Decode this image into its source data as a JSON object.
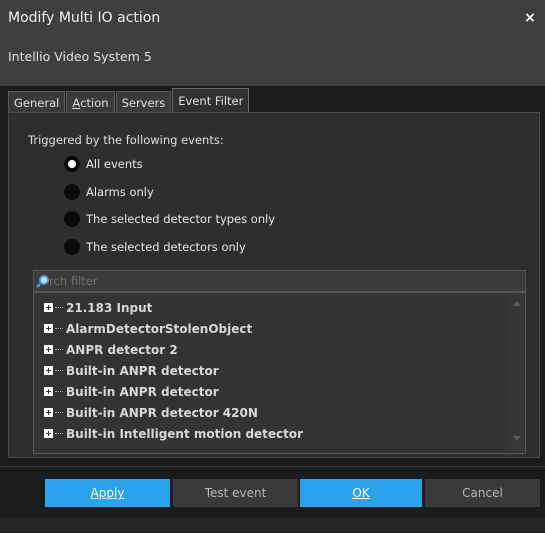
{
  "window": {
    "title": "Modify Multi IO action",
    "close_glyph": "×"
  },
  "subtitle": "Intellio Video System 5",
  "tabs": [
    {
      "label": "General",
      "active": false
    },
    {
      "label": "Action",
      "mnemonic": "A",
      "active": false
    },
    {
      "label": "Servers",
      "active": false
    },
    {
      "label": "Event Filter",
      "active": true
    }
  ],
  "event_filter": {
    "trigger_label": "Triggered by the following events:",
    "options": [
      {
        "label": "All events",
        "checked": true
      },
      {
        "label": "Alarms only",
        "checked": false
      },
      {
        "label": "The selected detector types only",
        "checked": false
      },
      {
        "label": "The selected detectors only",
        "checked": false
      }
    ],
    "search": {
      "placeholder": "rch filter",
      "icon": "search-icon"
    },
    "tree_items": [
      "21.183 Input",
      "AlarmDetectorStolenObject",
      "ANPR detector 2",
      "Built-in ANPR detector",
      "Built-in ANPR detector",
      "Built-in ANPR detector 420N",
      "Built-in Intelligent motion detector"
    ]
  },
  "buttons": {
    "apply": "Apply",
    "test_event": "Test event",
    "ok": "OK",
    "cancel": "Cancel"
  },
  "colors": {
    "accent": "#2aa3ec",
    "background": "#1b1b1b",
    "titlebar": "#3f3f3f"
  }
}
